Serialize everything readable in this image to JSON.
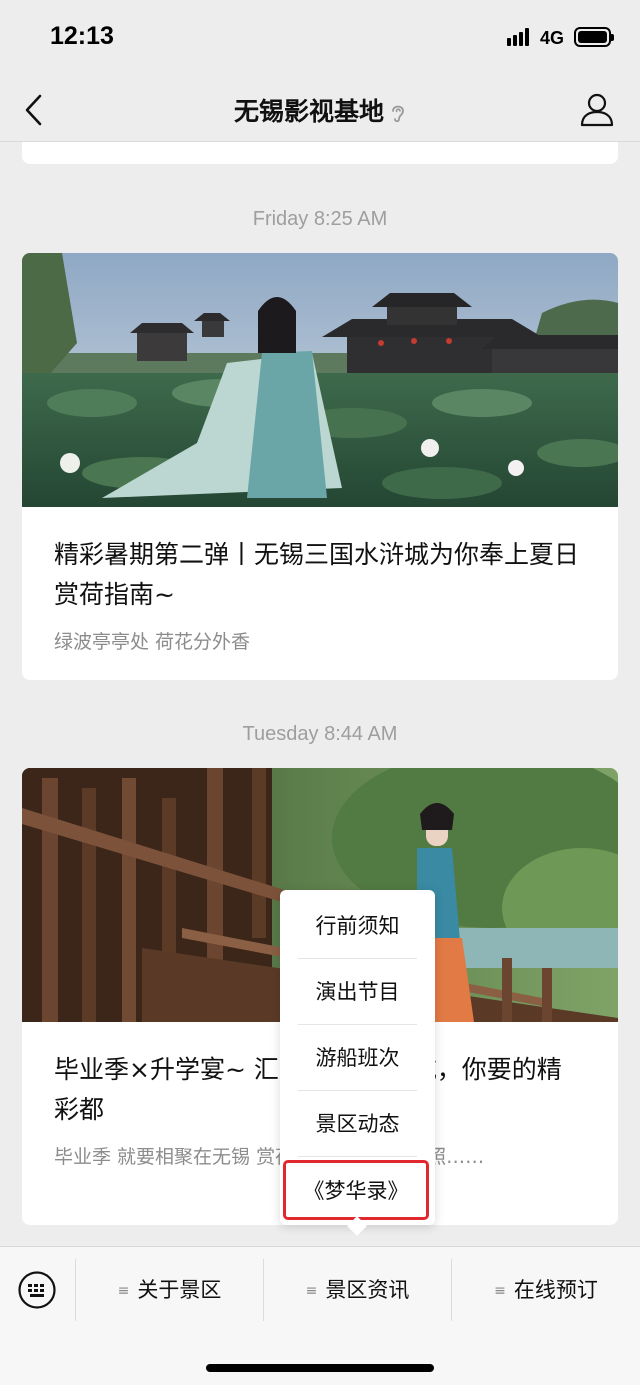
{
  "status": {
    "time": "12:13",
    "network": "4G"
  },
  "nav": {
    "title": "无锡影视基地"
  },
  "feed": [
    {
      "timestamp": "Friday 8:25 AM",
      "title": "精彩暑期第二弹丨无锡三国水浒城为你奉上夏日赏荷指南~",
      "digest": "绿波亭亭处 荷花分外香"
    },
    {
      "timestamp": "Tuesday 8:44 AM",
      "title": "毕业季×升学宴~ 汇 用免费游影城，你要的精彩都",
      "digest": "毕业季 就要相聚在无锡 赏荷、吃美食、拍美照……"
    }
  ],
  "popup_menu": {
    "items": [
      "行前须知",
      "演出节目",
      "游船班次",
      "景区动态",
      "《梦华录》"
    ]
  },
  "bottom_menu": {
    "items": [
      "关于景区",
      "景区资讯",
      "在线预订"
    ]
  },
  "colors": {
    "highlight": "#e0282e",
    "background": "#ededed"
  }
}
